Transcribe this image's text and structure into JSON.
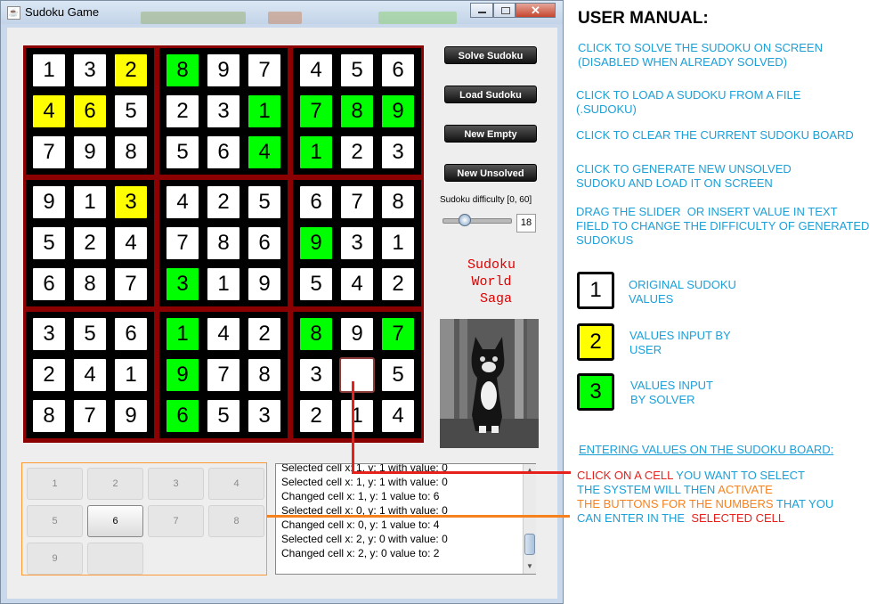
{
  "window": {
    "title": "Sudoku Game"
  },
  "board": {
    "rows": [
      [
        "1",
        "3",
        "2",
        "8",
        "9",
        "7",
        "4",
        "5",
        "6"
      ],
      [
        "4",
        "6",
        "5",
        "2",
        "3",
        "1",
        "7",
        "8",
        "9"
      ],
      [
        "7",
        "9",
        "8",
        "5",
        "6",
        "4",
        "1",
        "2",
        "3"
      ],
      [
        "9",
        "1",
        "3",
        "4",
        "2",
        "5",
        "6",
        "7",
        "8"
      ],
      [
        "5",
        "2",
        "4",
        "7",
        "8",
        "6",
        "9",
        "3",
        "1"
      ],
      [
        "6",
        "8",
        "7",
        "3",
        "1",
        "9",
        "5",
        "4",
        "2"
      ],
      [
        "3",
        "5",
        "6",
        "1",
        "4",
        "2",
        "8",
        "9",
        "7"
      ],
      [
        "2",
        "4",
        "1",
        "9",
        "7",
        "8",
        "3",
        "",
        "5"
      ],
      [
        "8",
        "7",
        "9",
        "6",
        "5",
        "3",
        "2",
        "1",
        "4"
      ]
    ],
    "types": [
      [
        "o",
        "o",
        "u",
        "s",
        "o",
        "o",
        "o",
        "o",
        "o"
      ],
      [
        "u",
        "u",
        "o",
        "o",
        "o",
        "s",
        "s",
        "s",
        "s"
      ],
      [
        "o",
        "o",
        "o",
        "o",
        "o",
        "s",
        "s",
        "o",
        "o"
      ],
      [
        "o",
        "o",
        "u",
        "o",
        "o",
        "o",
        "o",
        "o",
        "o"
      ],
      [
        "o",
        "o",
        "o",
        "o",
        "o",
        "o",
        "s",
        "o",
        "o"
      ],
      [
        "o",
        "o",
        "o",
        "s",
        "o",
        "o",
        "o",
        "o",
        "o"
      ],
      [
        "o",
        "o",
        "o",
        "s",
        "o",
        "o",
        "s",
        "o",
        "s"
      ],
      [
        "o",
        "o",
        "o",
        "s",
        "o",
        "o",
        "o",
        "e",
        "o"
      ],
      [
        "o",
        "o",
        "o",
        "s",
        "o",
        "o",
        "o",
        "o",
        "o"
      ]
    ],
    "colors": {
      "original": "#ffffff",
      "user": "#ffff00",
      "solver": "#00ff00",
      "frame": "#8b0000"
    }
  },
  "controls": {
    "solve": "Solve Sudoku",
    "load": "Load Sudoku",
    "new_empty": "New Empty",
    "new_unsolved": "New Unsolved",
    "difficulty_label": "Sudoku difficulty [0, 60]",
    "difficulty_value": "18",
    "difficulty_level": 18
  },
  "saga": {
    "line1": "Sudoku",
    "line2": "World",
    "line3": "Saga"
  },
  "numpad": {
    "buttons": [
      "1",
      "2",
      "3",
      "4",
      "5",
      "6",
      "7",
      "8",
      "9",
      ""
    ],
    "active": "6"
  },
  "log": {
    "lines": [
      "Selected cell x: 1, y: 1 with value: 0",
      "Selected cell x: 1, y: 1 with value: 0",
      "Changed cell x: 1, y: 1 value to: 6",
      "Selected cell x: 0, y: 1 with value: 0",
      "Changed cell x: 0, y: 1 value to: 4",
      "Selected cell x: 2, y: 0 with value: 0",
      "Changed cell x: 2, y: 0 value to: 2"
    ]
  },
  "manual": {
    "title": "USER MANUAL:",
    "solve": "CLICK TO SOLVE THE SUDOKU ON SCREEN\n(DISABLED WHEN ALREADY SOLVED)",
    "load": "CLICK TO LOAD A SUDOKU FROM A FILE\n(.SUDOKU)",
    "clear": "CLICK TO CLEAR THE CURRENT SUDOKU BOARD",
    "generate": "CLICK TO GENERATE NEW UNSOLVED\nSUDOKU AND LOAD IT ON SCREEN",
    "difficulty": "DRAG THE SLIDER  OR INSERT VALUE IN TEXT\nFIELD TO CHANGE THE DIFFICULTY OF GENERATED\nSUDOKUS",
    "legend": [
      {
        "value": "1",
        "label": "ORIGINAL SUDOKU\nVALUES"
      },
      {
        "value": "2",
        "label": "VALUES INPUT BY\nUSER"
      },
      {
        "value": "3",
        "label": "VALUES INPUT\nBY SOLVER"
      }
    ],
    "entering_title": "ENTERING VALUES ON THE SUDOKU BOARD:",
    "click_cell": "CLICK ON A CELL",
    "click_cell_rest": " YOU WANT TO SELECT",
    "system_will": "THE SYSTEM WILL THEN ",
    "activate": "ACTIVATE",
    "buttons_for": "THE BUTTONS FOR THE NUMBERS",
    "that_you": " THAT YOU",
    "can_enter": "CAN ENTER IN THE  ",
    "selected_cell": "SELECTED CELL",
    "colors": {
      "text": "#1ca0d8",
      "red": "#e8201c",
      "orange": "#f5821f"
    }
  }
}
